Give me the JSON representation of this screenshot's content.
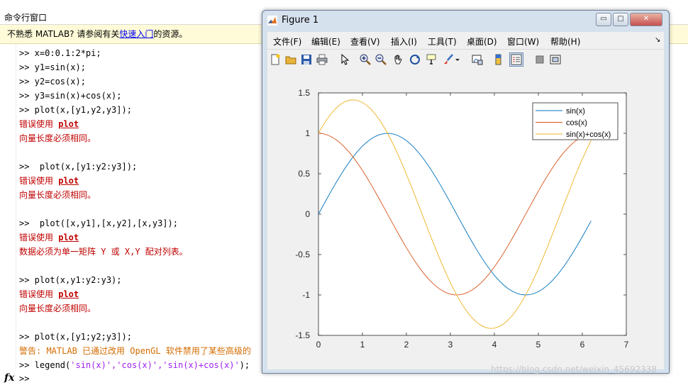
{
  "command_window": {
    "title": "命令行窗口",
    "notice": {
      "prefix": "不熟悉 MATLAB? 请参阅有关",
      "link": "快速入门",
      "suffix": "的资源。"
    },
    "lines": [
      {
        "kind": "prompt",
        "text": ">> x=0:0.1:2*pi;"
      },
      {
        "kind": "prompt",
        "text": ">> y1=sin(x);"
      },
      {
        "kind": "prompt",
        "text": ">> y2=cos(x);"
      },
      {
        "kind": "prompt",
        "text": ">> y3=sin(x)+cos(x);"
      },
      {
        "kind": "prompt",
        "text": ">> plot(x,[y1,y2,y3]);"
      },
      {
        "kind": "error-head",
        "text": "错误使用 ",
        "link": "plot"
      },
      {
        "kind": "error",
        "text": "向量长度必须相同。"
      },
      {
        "kind": "blank",
        "text": ""
      },
      {
        "kind": "prompt",
        "text": ">>  plot(x,[y1:y2:y3]);"
      },
      {
        "kind": "error-head",
        "text": "错误使用 ",
        "link": "plot"
      },
      {
        "kind": "error",
        "text": "向量长度必须相同。"
      },
      {
        "kind": "blank",
        "text": ""
      },
      {
        "kind": "prompt",
        "text": ">>  plot([x,y1],[x,y2],[x,y3]);"
      },
      {
        "kind": "error-head",
        "text": "错误使用 ",
        "link": "plot"
      },
      {
        "kind": "error",
        "text": "数据必须为单一矩阵 Y 或 X,Y 配对列表。"
      },
      {
        "kind": "blank",
        "text": ""
      },
      {
        "kind": "prompt",
        "text": ">> plot(x,y1:y2:y3);"
      },
      {
        "kind": "error-head",
        "text": "错误使用 ",
        "link": "plot"
      },
      {
        "kind": "error",
        "text": "向量长度必须相同。"
      },
      {
        "kind": "blank",
        "text": ""
      },
      {
        "kind": "prompt",
        "text": ">> plot(x,[y1;y2;y3]);"
      },
      {
        "kind": "warn",
        "text": "警告: MATLAB 已通过改用 OpenGL 软件禁用了某些高级的"
      },
      {
        "kind": "legend",
        "prefix": ">> legend(",
        "args": "'sin(x)','cos(x)','sin(x)+cos(x)'",
        "suffix": ");"
      }
    ],
    "fx_label": "fx",
    "current_prompt": ">>"
  },
  "figure_window": {
    "title": "Figure 1",
    "window_buttons": [
      "▭",
      "□",
      "✕"
    ],
    "menu": [
      "文件(F)",
      "编辑(E)",
      "查看(V)",
      "插入(I)",
      "工具(T)",
      "桌面(D)",
      "窗口(W)",
      "帮助(H)"
    ],
    "menu_overflow": "↘",
    "toolbar_icons": [
      "new-file-icon",
      "open-folder-icon",
      "save-icon",
      "print-icon",
      "pointer-icon",
      "zoom-in-icon",
      "zoom-out-icon",
      "pan-hand-icon",
      "rotate-3d-icon",
      "data-cursor-icon",
      "brush-icon",
      "brush-dropdown-icon",
      "link-plot-icon",
      "colorbar-icon",
      "legend-toggle-icon",
      "hide-plot-tools-icon",
      "show-plot-tools-icon"
    ]
  },
  "chart_data": {
    "type": "line",
    "title": "",
    "xlabel": "",
    "ylabel": "",
    "xlim": [
      0,
      7
    ],
    "ylim": [
      -1.5,
      1.5
    ],
    "xticks": [
      0,
      1,
      2,
      3,
      4,
      5,
      6,
      7
    ],
    "yticks": [
      -1.5,
      -1,
      -0.5,
      0,
      0.5,
      1,
      1.5
    ],
    "x": [
      0,
      0.1,
      0.2,
      0.3,
      0.4,
      0.5,
      0.6,
      0.7,
      0.8,
      0.9,
      1,
      1.1,
      1.2,
      1.3,
      1.4,
      1.5,
      1.6,
      1.7,
      1.8,
      1.9,
      2,
      2.1,
      2.2,
      2.3,
      2.4,
      2.5,
      2.6,
      2.7,
      2.8,
      2.9,
      3,
      3.1,
      3.2,
      3.3,
      3.4,
      3.5,
      3.6,
      3.7,
      3.8,
      3.9,
      4,
      4.1,
      4.2,
      4.3,
      4.4,
      4.5,
      4.6,
      4.7,
      4.8,
      4.9,
      5,
      5.1,
      5.2,
      5.3,
      5.4,
      5.5,
      5.6,
      5.7,
      5.8,
      5.9,
      6,
      6.1,
      6.2
    ],
    "series": [
      {
        "name": "sin(x)",
        "color": "#0072bd",
        "values": [
          0,
          0.0998,
          0.1987,
          0.2955,
          0.3894,
          0.4794,
          0.5646,
          0.6442,
          0.7174,
          0.7833,
          0.8415,
          0.8912,
          0.932,
          0.9636,
          0.9854,
          0.9975,
          0.9996,
          0.9917,
          0.9738,
          0.9463,
          0.9093,
          0.8632,
          0.8085,
          0.7457,
          0.6755,
          0.5985,
          0.5155,
          0.4274,
          0.335,
          0.2392,
          0.1411,
          0.0416,
          -0.0584,
          -0.1577,
          -0.2555,
          -0.3508,
          -0.4425,
          -0.5298,
          -0.6119,
          -0.6878,
          -0.7568,
          -0.8183,
          -0.8716,
          -0.9162,
          -0.9516,
          -0.9775,
          -0.9937,
          -0.9999,
          -0.9962,
          -0.9825,
          -0.9589,
          -0.9258,
          -0.8835,
          -0.8323,
          -0.7728,
          -0.7055,
          -0.6313,
          -0.5507,
          -0.4646,
          -0.3739,
          -0.2794,
          -0.1822,
          -0.0831
        ]
      },
      {
        "name": "cos(x)",
        "color": "#d95319",
        "values": [
          1,
          0.995,
          0.9801,
          0.9553,
          0.9211,
          0.8776,
          0.8253,
          0.7648,
          0.6967,
          0.6216,
          0.5403,
          0.4536,
          0.3624,
          0.2675,
          0.17,
          0.0707,
          -0.0292,
          -0.1288,
          -0.2272,
          -0.3233,
          -0.4161,
          -0.5048,
          -0.5885,
          -0.6663,
          -0.7374,
          -0.8011,
          -0.8569,
          -0.9041,
          -0.9422,
          -0.971,
          -0.99,
          -0.9991,
          -0.9983,
          -0.9875,
          -0.9668,
          -0.9365,
          -0.8968,
          -0.8481,
          -0.791,
          -0.7259,
          -0.6536,
          -0.5748,
          -0.4903,
          -0.4008,
          -0.3073,
          -0.2108,
          -0.1122,
          -0.0124,
          0.0875,
          0.1865,
          0.2837,
          0.378,
          0.4685,
          0.5544,
          0.6347,
          0.7087,
          0.7756,
          0.8347,
          0.8855,
          0.9275,
          0.9602,
          0.9833,
          0.9965
        ]
      },
      {
        "name": "sin(x)+cos(x)",
        "color": "#edb120",
        "values": [
          1,
          1.0948,
          1.1788,
          1.2508,
          1.3105,
          1.357,
          1.3899,
          1.409,
          1.4141,
          1.4049,
          1.3818,
          1.3448,
          1.2944,
          1.2311,
          1.1554,
          1.0682,
          0.9704,
          0.8629,
          0.7466,
          0.623,
          0.4932,
          0.3584,
          0.22,
          0.0794,
          -0.0619,
          -0.2026,
          -0.3414,
          -0.4767,
          -0.6072,
          -0.7318,
          -0.8489,
          -0.9575,
          -1.0567,
          -1.1452,
          -1.2223,
          -1.2873,
          -1.3393,
          -1.3779,
          -1.4029,
          -1.4137,
          -1.4104,
          -1.3931,
          -1.3619,
          -1.317,
          -1.2589,
          -1.1883,
          -1.1059,
          -1.0123,
          -0.9087,
          -0.796,
          -0.6752,
          -0.5478,
          -0.415,
          -0.2779,
          -0.1381,
          0.0032,
          0.1443,
          0.284,
          0.4209,
          0.5536,
          0.6808,
          0.8011,
          0.9134
        ]
      }
    ],
    "legend_position": "top-right",
    "grid": false
  },
  "watermark": "https://blog.csdn.net/weixin_45692338"
}
